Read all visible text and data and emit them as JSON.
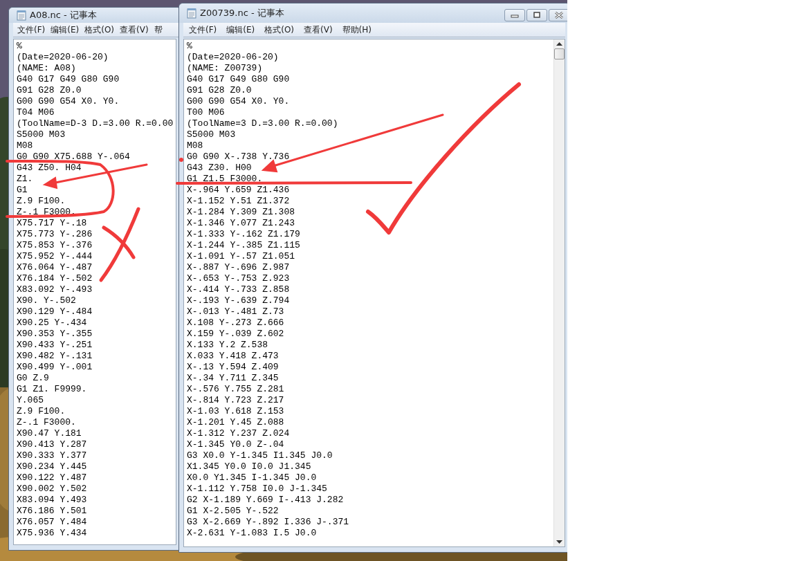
{
  "windows": [
    {
      "title": "A08.nc - 记事本",
      "active": false,
      "menu": [
        "文件(F)",
        "编辑(E)",
        "格式(O)",
        "查看(V)",
        "帮"
      ],
      "lines": [
        "%",
        "(Date=2020-06-20)",
        "(NAME: A08)",
        "G40 G17 G49 G80 G90",
        "G91 G28 Z0.0",
        "G00 G90 G54 X0. Y0.",
        "T04 M06",
        "(ToolName=D-3 D.=3.00 R.=0.00",
        "S5000 M03",
        "M08",
        "G0 G90 X75.688 Y-.064",
        "G43 Z50. H04",
        "Z1.",
        "G1",
        "Z.9 F100.",
        "Z-.1 F3000.",
        "X75.717 Y-.18",
        "X75.773 Y-.286",
        "X75.853 Y-.376",
        "X75.952 Y-.444",
        "X76.064 Y-.487",
        "X76.184 Y-.502",
        "X83.092 Y-.493",
        "X90. Y-.502",
        "X90.129 Y-.484",
        "X90.25 Y-.434",
        "X90.353 Y-.355",
        "X90.433 Y-.251",
        "X90.482 Y-.131",
        "X90.499 Y-.001",
        "G0 Z.9",
        "G1 Z1. F9999.",
        "Y.065",
        "Z.9 F100.",
        "Z-.1 F3000.",
        "X90.47 Y.181",
        "X90.413 Y.287",
        "X90.333 Y.377",
        "X90.234 Y.445",
        "X90.122 Y.487",
        "X90.002 Y.502",
        "X83.094 Y.493",
        "X76.186 Y.501",
        "X76.057 Y.484",
        "X75.936 Y.434"
      ]
    },
    {
      "title": "Z00739.nc - 记事本",
      "active": true,
      "menu": [
        "文件(F)",
        "编辑(E)",
        "格式(O)",
        "查看(V)",
        "帮助(H)"
      ],
      "lines": [
        "%",
        "(Date=2020-06-20)",
        "(NAME: Z00739)",
        "G40 G17 G49 G80 G90",
        "G91 G28 Z0.0",
        "G00 G90 G54 X0. Y0.",
        "T00 M06",
        "(ToolName=3 D.=3.00 R.=0.00)",
        "S5000 M03",
        "M08",
        "G0 G90 X-.738 Y.736",
        "G43 Z30. H00",
        "G1 Z1.5 F3000.",
        "X-.964 Y.659 Z1.436",
        "X-1.152 Y.51 Z1.372",
        "X-1.284 Y.309 Z1.308",
        "X-1.346 Y.077 Z1.243",
        "X-1.333 Y-.162 Z1.179",
        "X-1.244 Y-.385 Z1.115",
        "X-1.091 Y-.57 Z1.051",
        "X-.887 Y-.696 Z.987",
        "X-.653 Y-.753 Z.923",
        "X-.414 Y-.733 Z.858",
        "X-.193 Y-.639 Z.794",
        "X-.013 Y-.481 Z.73",
        "X.108 Y-.273 Z.666",
        "X.159 Y-.039 Z.602",
        "X.133 Y.2 Z.538",
        "X.033 Y.418 Z.473",
        "X-.13 Y.594 Z.409",
        "X-.34 Y.711 Z.345",
        "X-.576 Y.755 Z.281",
        "X-.814 Y.723 Z.217",
        "X-1.03 Y.618 Z.153",
        "X-1.201 Y.45 Z.088",
        "X-1.312 Y.237 Z.024",
        "X-1.345 Y0.0 Z-.04",
        "G3 X0.0 Y-1.345 I1.345 J0.0",
        "X1.345 Y0.0 I0.0 J1.345",
        "X0.0 Y1.345 I-1.345 J0.0",
        "X-1.112 Y.758 I0.0 J-1.345",
        "G2 X-1.189 Y.669 I-.413 J.282",
        "G1 X-2.505 Y-.522",
        "G3 X-2.669 Y-.892 I.336 J-.371",
        "X-2.631 Y-1.083 I.5 J0.0"
      ]
    }
  ]
}
